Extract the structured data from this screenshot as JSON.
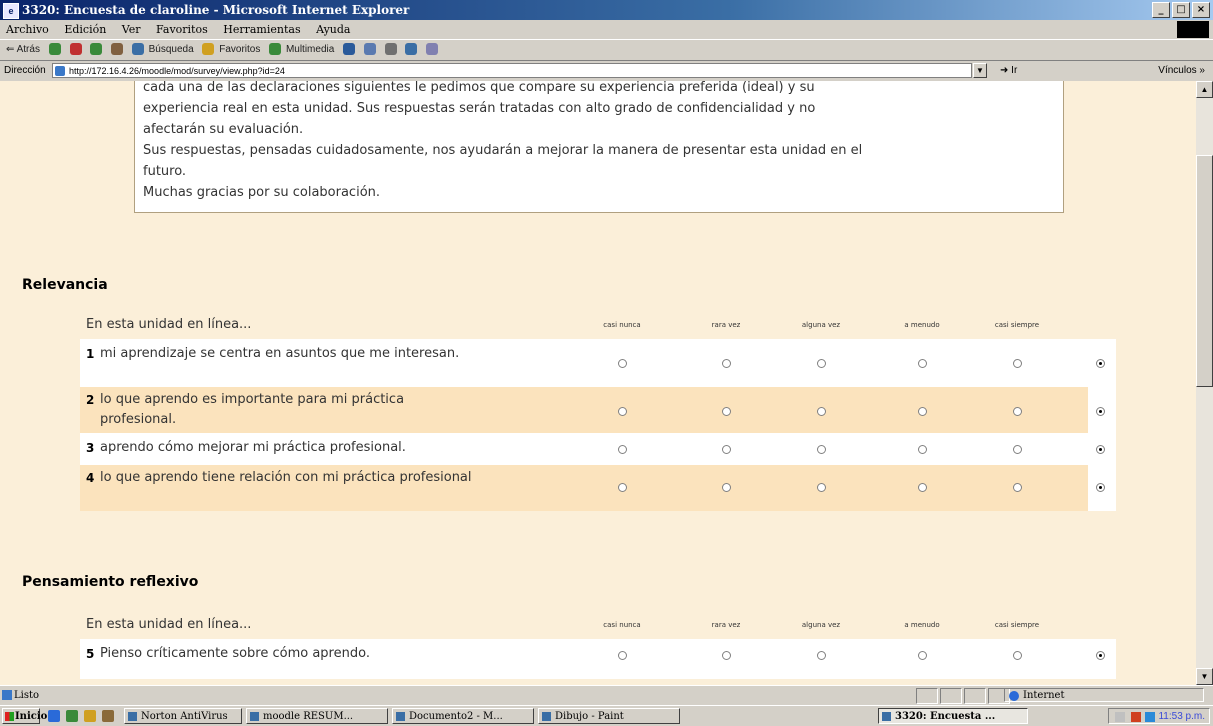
{
  "window": {
    "title": "3320: Encuesta de claroline - Microsoft Internet Explorer",
    "controls": [
      "_",
      "□",
      "×"
    ]
  },
  "menu": [
    "Archivo",
    "Edición",
    "Ver",
    "Favoritos",
    "Herramientas",
    "Ayuda"
  ],
  "toolbar": {
    "back": "⇐ Atrás",
    "search": "Búsqueda",
    "favorites": "Favoritos",
    "multimedia": "Multimedia"
  },
  "address": {
    "label": "Dirección",
    "url": "http://172.16.4.26/moodle/mod/survey/view.php?id=24",
    "go": "Ir",
    "links": "Vínculos »"
  },
  "intro": {
    "lines": [
      "cada una de las declaraciones siguientes le pedimos que compare su experiencia preferida (ideal) y su",
      "experiencia real en esta unidad. Sus respuestas serán tratadas con alto grado de confidencialidad y no",
      "afectarán su evaluación.",
      "Sus respuestas, pensadas cuidadosamente, nos ayudarán a mejorar la manera de presentar esta unidad en el",
      "futuro.",
      "Muchas gracias por su colaboración."
    ]
  },
  "options": [
    "casi nunca",
    "rara vez",
    "alguna vez",
    "a menudo",
    "casi siempre"
  ],
  "sections": [
    {
      "title": "Relevancia",
      "header": "En esta unidad en línea...",
      "questions": [
        {
          "num": "1",
          "text": "mi aprendizaje se centra en asuntos que me interesan."
        },
        {
          "num": "2",
          "text": "lo que aprendo es importante para mi práctica profesional."
        },
        {
          "num": "3",
          "text": "aprendo cómo mejorar mi práctica profesional."
        },
        {
          "num": "4",
          "text": "lo que aprendo tiene relación con mi práctica profesional"
        }
      ]
    },
    {
      "title": "Pensamiento reflexivo",
      "header": "En esta unidad en línea...",
      "questions": [
        {
          "num": "5",
          "text": "Pienso críticamente sobre cómo aprendo."
        }
      ]
    }
  ],
  "status": {
    "text": "Listo",
    "zone": "Internet"
  },
  "taskbar": {
    "start": "Inicio",
    "tasks": [
      "Norton AntiVirus",
      "moodle RESUM...",
      "Documento2 - M...",
      "Dibujo - Paint",
      "3320: Encuesta ..."
    ],
    "clock": "11:53 p.m."
  }
}
